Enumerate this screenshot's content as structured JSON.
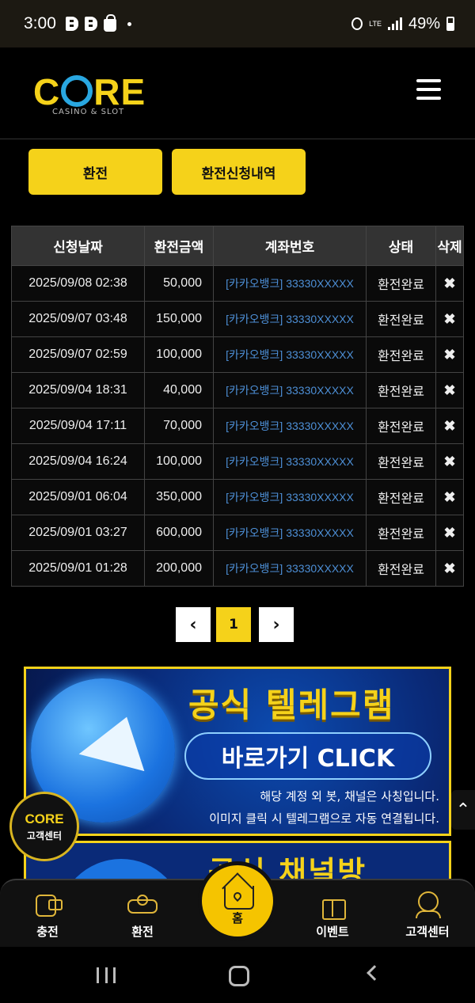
{
  "status_bar": {
    "time": "3:00",
    "network": "LTE",
    "battery": "49%",
    "icons": [
      "b-icon",
      "b-icon",
      "shopping-bag-icon",
      "dot-icon",
      "alarm-icon",
      "lte-icon",
      "signal-icon",
      "battery-icon"
    ]
  },
  "header": {
    "logo_main": "CORE",
    "logo_sub": "CASINO & SLOT",
    "menu_icon": "hamburger-icon"
  },
  "tabs": [
    {
      "label": "환전"
    },
    {
      "label": "환전신청내역"
    }
  ],
  "table": {
    "headers": [
      "신청날짜",
      "환전금액",
      "계좌번호",
      "상태",
      "삭제"
    ],
    "rows": [
      {
        "date": "2025/09/08 02:38",
        "amount": "50,000",
        "account": "[카카오뱅크] 33330XXXXX",
        "status": "환전완료",
        "delete": "✖"
      },
      {
        "date": "2025/09/07 03:48",
        "amount": "150,000",
        "account": "[카카오뱅크] 33330XXXXX",
        "status": "환전완료",
        "delete": "✖"
      },
      {
        "date": "2025/09/07 02:59",
        "amount": "100,000",
        "account": "[카카오뱅크] 33330XXXXX",
        "status": "환전완료",
        "delete": "✖"
      },
      {
        "date": "2025/09/04 18:31",
        "amount": "40,000",
        "account": "[카카오뱅크] 33330XXXXX",
        "status": "환전완료",
        "delete": "✖"
      },
      {
        "date": "2025/09/04 17:11",
        "amount": "70,000",
        "account": "[카카오뱅크] 33330XXXXX",
        "status": "환전완료",
        "delete": "✖"
      },
      {
        "date": "2025/09/04 16:24",
        "amount": "100,000",
        "account": "[카카오뱅크] 33330XXXXX",
        "status": "환전완료",
        "delete": "✖"
      },
      {
        "date": "2025/09/01 06:04",
        "amount": "350,000",
        "account": "[카카오뱅크] 33330XXXXX",
        "status": "환전완료",
        "delete": "✖"
      },
      {
        "date": "2025/09/01 03:27",
        "amount": "600,000",
        "account": "[카카오뱅크] 33330XXXXX",
        "status": "환전완료",
        "delete": "✖"
      },
      {
        "date": "2025/09/01 01:28",
        "amount": "200,000",
        "account": "[카카오뱅크] 33330XXXXX",
        "status": "환전완료",
        "delete": "✖"
      }
    ]
  },
  "pagination": {
    "prev": "‹",
    "current": "1",
    "next": "›"
  },
  "banner": {
    "title": "공식 텔레그램",
    "cta": "바로가기 CLICK",
    "line1": "해당 계정 외 봇, 채널은 사칭입니다.",
    "line2": "이미지 클릭 시 텔레그램으로 자동 연결됩니다.",
    "icon": "telegram-icon"
  },
  "banner2": {
    "title": "공식 채널방"
  },
  "support_fab": {
    "logo": "CORE",
    "label": "고객센터"
  },
  "scroll_top": {
    "glyph": "⌃"
  },
  "bottom_nav": {
    "items": [
      {
        "label": "충전",
        "icon": "charge-icon"
      },
      {
        "label": "환전",
        "icon": "exchange-icon"
      },
      {
        "label": "홈",
        "icon": "home-icon"
      },
      {
        "label": "이벤트",
        "icon": "gift-icon"
      },
      {
        "label": "고객센터",
        "icon": "support-agent-icon"
      }
    ]
  },
  "colors": {
    "accent": "#f5d21a",
    "link": "#4d8fd6",
    "background": "#000000"
  }
}
